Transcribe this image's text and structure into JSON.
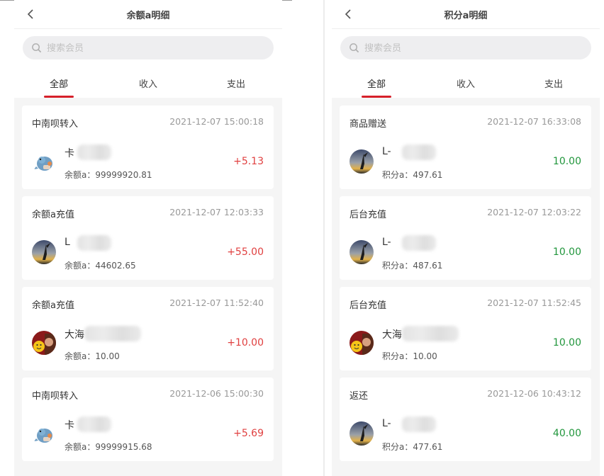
{
  "left": {
    "title": "余额a明细",
    "search_placeholder": "搜索会员",
    "tabs": [
      "全部",
      "收入",
      "支出"
    ],
    "records": [
      {
        "type": "中南呗转入",
        "time": "2021-12-07 15:00:18",
        "name": "卡",
        "balance": "余额a：99999920.81",
        "amount": "+5.13",
        "avatar": "dragon-avatar"
      },
      {
        "type": "余额a充值",
        "time": "2021-12-07 12:03:33",
        "name": "L",
        "balance": "余额a：44602.65",
        "amount": "+55.00",
        "avatar": "sunset-avatar"
      },
      {
        "type": "余额a充值",
        "time": "2021-12-07 11:52:40",
        "name": "大海",
        "balance": "余额a：10.00",
        "amount": "+10.00",
        "avatar": "emoji-avatar"
      },
      {
        "type": "中南呗转入",
        "time": "2021-12-06 15:00:30",
        "name": "卡",
        "balance": "余额a：99999915.68",
        "amount": "+5.69",
        "avatar": "dragon-avatar"
      }
    ]
  },
  "right": {
    "title": "积分a明细",
    "search_placeholder": "搜索会员",
    "tabs": [
      "全部",
      "收入",
      "支出"
    ],
    "records": [
      {
        "type": "商品赠送",
        "time": "2021-12-07 16:33:08",
        "name": "L-",
        "balance": "积分a：497.61",
        "amount": "10.00",
        "avatar": "sunset-avatar"
      },
      {
        "type": "后台充值",
        "time": "2021-12-07 12:03:22",
        "name": "L-",
        "balance": "积分a：487.61",
        "amount": "10.00",
        "avatar": "sunset-avatar"
      },
      {
        "type": "后台充值",
        "time": "2021-12-07 11:52:45",
        "name": "大海",
        "balance": "积分a：10.00",
        "amount": "10.00",
        "avatar": "emoji-avatar"
      },
      {
        "type": "返还",
        "time": "2021-12-06 10:43:12",
        "name": "L-",
        "balance": "积分a：477.61",
        "amount": "40.00",
        "avatar": "sunset-avatar"
      }
    ]
  },
  "colors": {
    "accent": "#d6202a",
    "income_red": "#e04040",
    "points_green": "#21963c"
  }
}
